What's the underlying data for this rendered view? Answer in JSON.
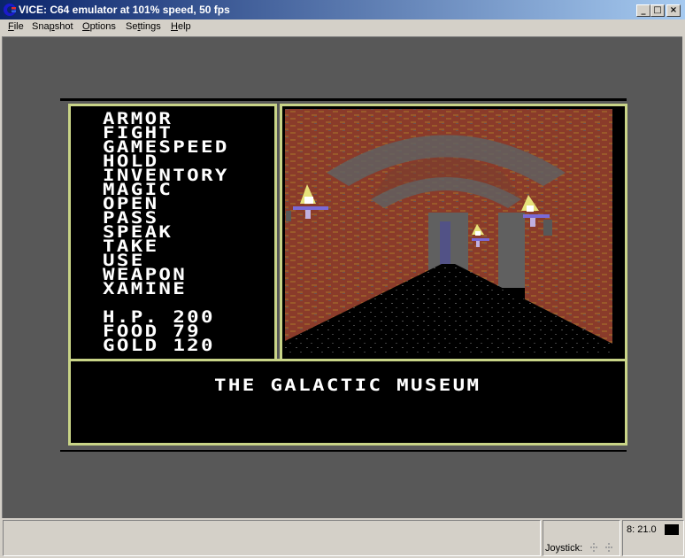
{
  "window": {
    "title": "VICE: C64 emulator at 101% speed, 50 fps",
    "icon": "vice-app-icon",
    "controls": {
      "minimize": "_",
      "maximize": "□",
      "close": "×"
    }
  },
  "menubar": {
    "items": [
      {
        "label": "File",
        "accel": "F"
      },
      {
        "label": "Snapshot",
        "accel": "p"
      },
      {
        "label": "Options",
        "accel": "O"
      },
      {
        "label": "Settings",
        "accel": "t"
      },
      {
        "label": "Help",
        "accel": "H"
      }
    ]
  },
  "game": {
    "commands": [
      "ARMOR",
      "FIGHT",
      "GAMESPEED",
      "HOLD",
      "INVENTORY",
      "MAGIC",
      "OPEN",
      "PASS",
      "SPEAK",
      "TAKE",
      "USE",
      "WEAPON",
      "XAMINE"
    ],
    "stats": [
      {
        "label": "H.P.",
        "value": "200"
      },
      {
        "label": "FOOD",
        "value": "79"
      },
      {
        "label": "GOLD",
        "value": "120"
      }
    ],
    "location": "THE GALACTIC MUSEUM",
    "scene": "dungeon-corridor-with-torches",
    "colors": {
      "frame": "#c9d487",
      "screen_border": "#585858",
      "wall": "#8a3b2a",
      "brick": "#9a5a2a",
      "arch": "#606060",
      "torch_flame": "#e6e27a",
      "torch_base": "#7a6ad6"
    }
  },
  "statusbar": {
    "joystick_label": "Joystick:",
    "drive_status": "8: 21.0"
  }
}
